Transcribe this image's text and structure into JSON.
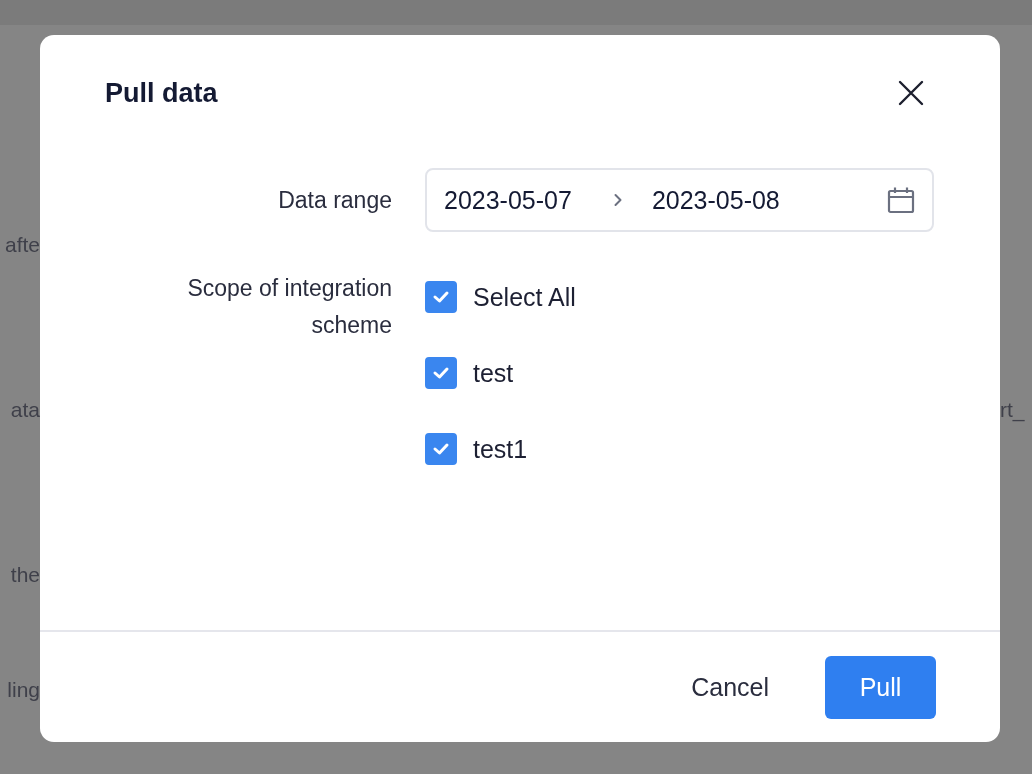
{
  "background": {
    "left_texts": [
      "afte",
      "ata",
      "the",
      "ling"
    ],
    "right_texts": [
      "rt_"
    ]
  },
  "dialog": {
    "title": "Pull data",
    "fields": [
      {
        "label": "Data range",
        "kind": "date_range",
        "start": "2023-05-07",
        "end": "2023-05-08"
      },
      {
        "label": "Scope of integration scheme",
        "kind": "checkbox_list",
        "options": [
          {
            "label": "Select All",
            "checked": true
          },
          {
            "label": "test",
            "checked": true
          },
          {
            "label": "test1",
            "checked": true
          }
        ]
      }
    ],
    "buttons": [
      {
        "label": "Cancel",
        "kind": "secondary"
      },
      {
        "label": "Pull",
        "kind": "primary"
      }
    ]
  }
}
